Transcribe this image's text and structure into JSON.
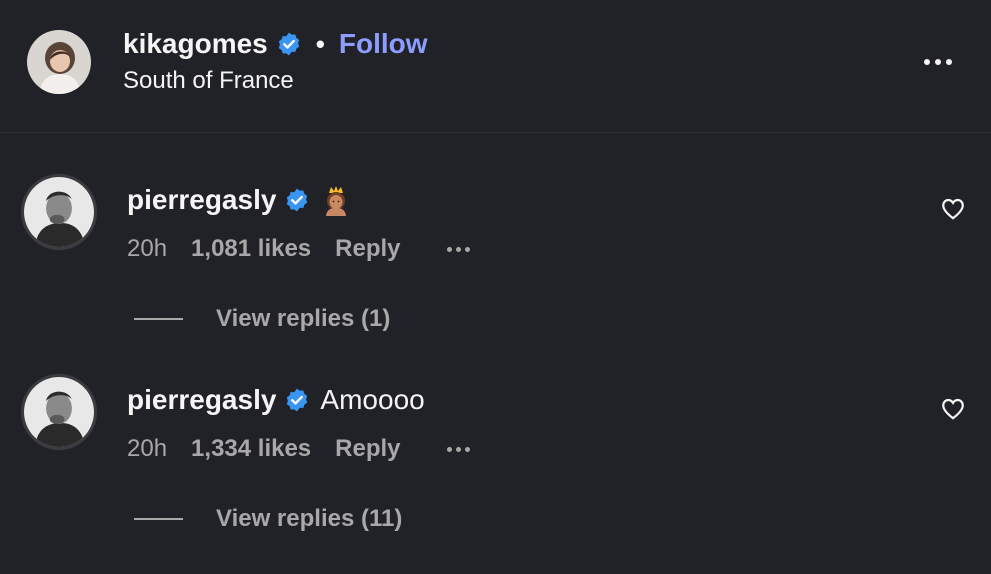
{
  "header": {
    "username": "kikagomes",
    "separator": "•",
    "follow_label": "Follow",
    "location": "South of France",
    "verified_icon": "verified-badge-icon",
    "more_icon": "more-options-icon"
  },
  "comments": [
    {
      "username": "pierregasly",
      "text": "",
      "emoji_icon": "princess-emoji-icon",
      "time": "20h",
      "likes": "1,081 likes",
      "reply_label": "Reply",
      "view_replies": "View replies (1)"
    },
    {
      "username": "pierregasly",
      "text": "Amoooo",
      "time": "20h",
      "likes": "1,334 likes",
      "reply_label": "Reply",
      "view_replies": "View replies (11)"
    }
  ],
  "colors": {
    "background": "#212227",
    "follow": "#8c9cff",
    "verified": "#3a96f2",
    "secondary_text": "#a8a8a8"
  }
}
